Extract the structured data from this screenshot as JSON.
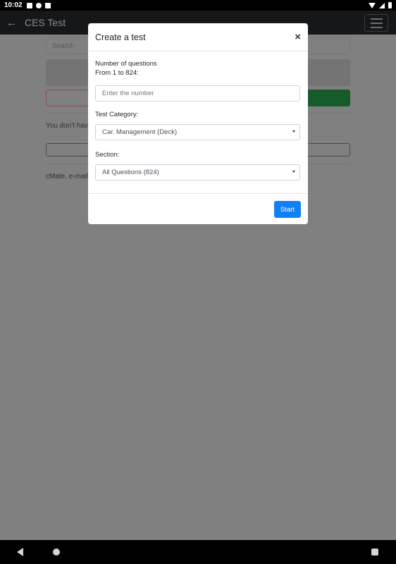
{
  "status_bar": {
    "time": "10:02"
  },
  "app_bar": {
    "title": "CES Test"
  },
  "background": {
    "search_placeholder": "Search",
    "no_tests_text": "You don't hav",
    "contact_text": "cMate. e-mail"
  },
  "modal": {
    "title": "Create a test",
    "close_glyph": "×",
    "questions_label": "Number of questions",
    "range_label": "From 1 to 824:",
    "number_placeholder": "Enter the number",
    "category_label": "Test Category:",
    "category_value": "Car. Management (Deck)",
    "section_label": "Section:",
    "section_value": "All Questions (824)",
    "start_label": "Start"
  },
  "colors": {
    "primary": "#1081f5",
    "overlay": "#808080"
  }
}
